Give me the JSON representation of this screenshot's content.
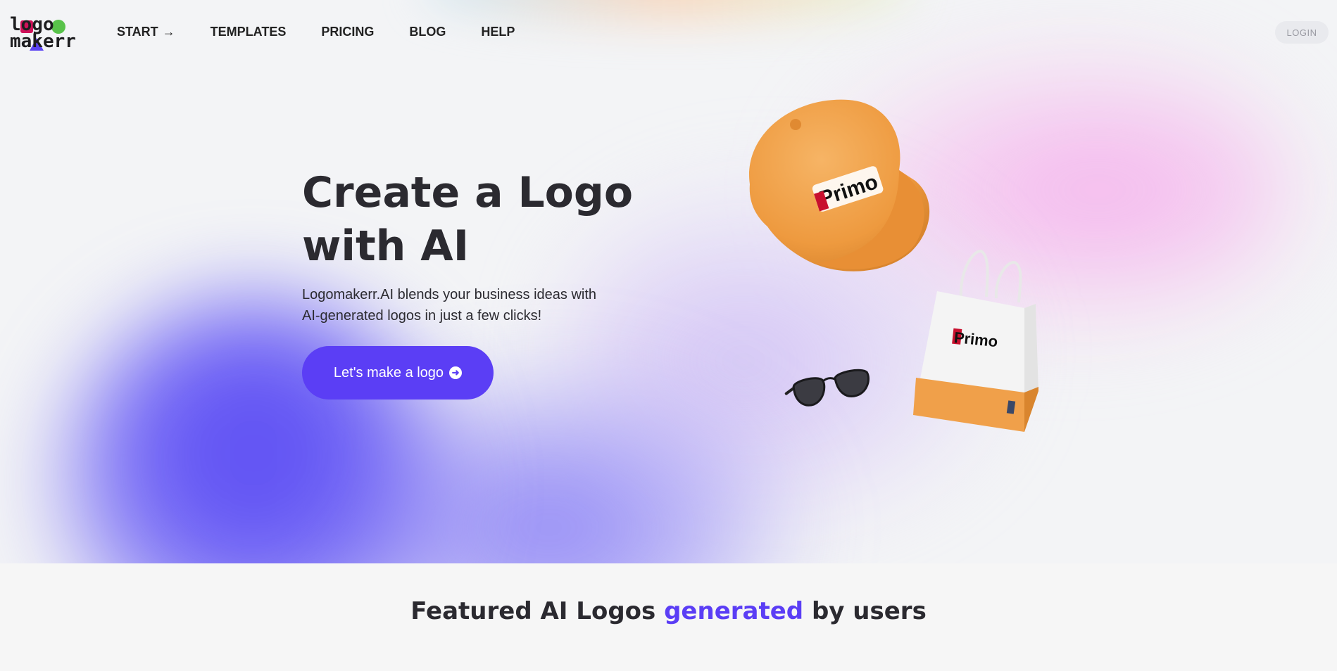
{
  "nav": {
    "logo": {
      "line1": "logo",
      "line2": "makerr"
    },
    "links": [
      {
        "label": "START",
        "arrow": "→"
      },
      {
        "label": "TEMPLATES"
      },
      {
        "label": "PRICING"
      },
      {
        "label": "BLOG"
      },
      {
        "label": "HELP"
      }
    ],
    "login_label": "LOGIN"
  },
  "hero": {
    "title_line1": "Create a Logo",
    "title_line2": "with AI",
    "subtitle_line1": "Logomakerr.AI blends your business ideas with",
    "subtitle_line2": "AI-generated logos in just a few clicks!",
    "cta_label": "Let's make a logo",
    "cta_icon": "arrow-circle-right-icon",
    "mockups": {
      "brand_text": "Primo",
      "items": [
        "cap",
        "sunglasses",
        "shopping-bag"
      ]
    }
  },
  "featured": {
    "title_before": "Featured AI Logos ",
    "title_accent": "generated",
    "title_after": " by users"
  },
  "colors": {
    "brand": "#5b3ef5",
    "text": "#2b2a30",
    "logo_square": "#d0125a",
    "logo_circle": "#58c24a",
    "cap_orange": "#f0a04a"
  }
}
